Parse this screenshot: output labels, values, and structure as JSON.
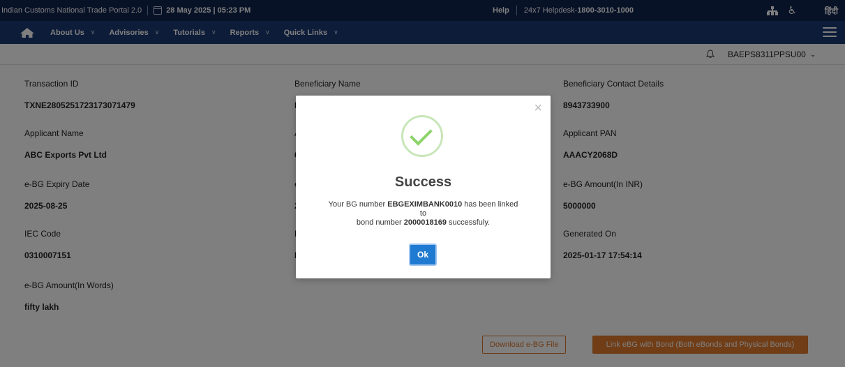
{
  "topbar": {
    "portal_title": "Indian Customs National Trade Portal 2.0",
    "date": "28 May 2025 | 05:23 PM",
    "help": "Help",
    "helpdesk_prefix": "24x7 Helpdesk-",
    "helpdesk_number": "1800-3010-1000",
    "language": "हिंदी"
  },
  "navbar": {
    "items": [
      {
        "label": "About Us"
      },
      {
        "label": "Advisories"
      },
      {
        "label": "Tutorials"
      },
      {
        "label": "Reports"
      },
      {
        "label": "Quick Links"
      }
    ]
  },
  "subbar": {
    "user_id": "BAEPS8311PPSU00"
  },
  "details": {
    "transaction_id": {
      "label": "Transaction ID",
      "value": "TXNE2805251723173071479"
    },
    "beneficiary_name": {
      "label": "Beneficiary Name",
      "value": ""
    },
    "beneficiary_contact": {
      "label": "Beneficiary Contact Details",
      "value": "8943733900"
    },
    "applicant_name": {
      "label": "Applicant Name",
      "value": "ABC Exports Pvt Ltd"
    },
    "applicant_pan": {
      "label": "Applicant PAN",
      "value": "AAACY2068D"
    },
    "ebg_expiry": {
      "label": "e-BG Expiry Date",
      "value": "2025-08-25"
    },
    "ebg_amount_inr": {
      "label": "e-BG Amount(In INR)",
      "value": "5000000"
    },
    "iec_code": {
      "label": "IEC Code",
      "value": "0310007151"
    },
    "generated_on": {
      "label": "Generated On",
      "value": "2025-01-17 17:54:14"
    },
    "ebg_amount_words": {
      "label": "e-BG Amount(In Words)",
      "value": "fifty lakh"
    },
    "partial_labels": [
      "I",
      "A",
      "6",
      "e",
      "2",
      "E",
      "F"
    ]
  },
  "buttons": {
    "download": "Download e-BG File",
    "link": "Link eBG with Bond (Both eBonds and Physical Bonds)"
  },
  "modal": {
    "close": "×",
    "title": "Success",
    "msg_part1": "Your BG number ",
    "bg_number": "EBGEXIMBANK0010",
    "msg_part2": " has been linked",
    "msg_to": "to",
    "msg_part3": "bond number ",
    "bond_number": "2000018169",
    "msg_part4": " successfuly.",
    "ok": "Ok"
  },
  "colors": {
    "topbar": "#11244f",
    "navbar": "#1b3872",
    "accent_orange": "#e07b2c",
    "ok_button": "#1f7bd1",
    "success_check": "#8cd46a"
  }
}
